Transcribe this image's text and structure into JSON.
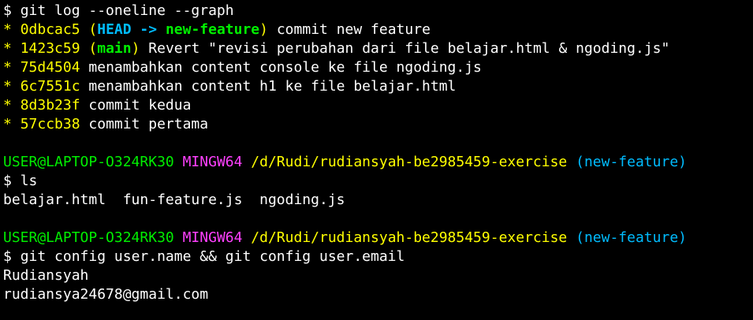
{
  "terminal": {
    "cmd1": {
      "prompt_symbol": "$",
      "command": "git log --oneline --graph"
    },
    "log": [
      {
        "graph": "*",
        "hash": "0dbcac5",
        "paren_open": "(",
        "head": "HEAD -> ",
        "branch": "new-feature",
        "paren_close": ")",
        "message": "commit new feature"
      },
      {
        "graph": "*",
        "hash": "1423c59",
        "paren_open": "(",
        "branch": "main",
        "paren_close": ")",
        "message": "Revert \"revisi perubahan dari file belajar.html & ngoding.js\""
      },
      {
        "graph": "*",
        "hash": "75d4504",
        "message": "menambahkan content console ke file ngoding.js"
      },
      {
        "graph": "*",
        "hash": "6c7551c",
        "message": "menambahkan content h1 ke file belajar.html"
      },
      {
        "graph": "*",
        "hash": "8d3b23f",
        "message": "commit kedua"
      },
      {
        "graph": "*",
        "hash": "57ccb38",
        "message": "commit pertama"
      }
    ],
    "prompt1": {
      "user_host": "USER@LAPTOP-O324RK30",
      "env": "MINGW64",
      "path": "/d/Rudi/rudiansyah-be2985459-exercise",
      "branch": "(new-feature)"
    },
    "cmd2": {
      "prompt_symbol": "$",
      "command": "ls"
    },
    "ls_output": "belajar.html  fun-feature.js  ngoding.js",
    "prompt2": {
      "user_host": "USER@LAPTOP-O324RK30",
      "env": "MINGW64",
      "path": "/d/Rudi/rudiansyah-be2985459-exercise",
      "branch": "(new-feature)"
    },
    "cmd3": {
      "prompt_symbol": "$",
      "command": "git config user.name && git config user.email"
    },
    "output_name": "Rudiansyah",
    "output_email": "rudiansya24678@gmail.com"
  },
  "colors": {
    "background": "#000000",
    "text": "#ffffff",
    "hash": "#ffff00",
    "head": "#00bcff",
    "branch": "#00ee00",
    "user_host": "#00ee00",
    "env": "#ff40ff",
    "path": "#ffff00",
    "prompt_branch": "#00bcff"
  }
}
